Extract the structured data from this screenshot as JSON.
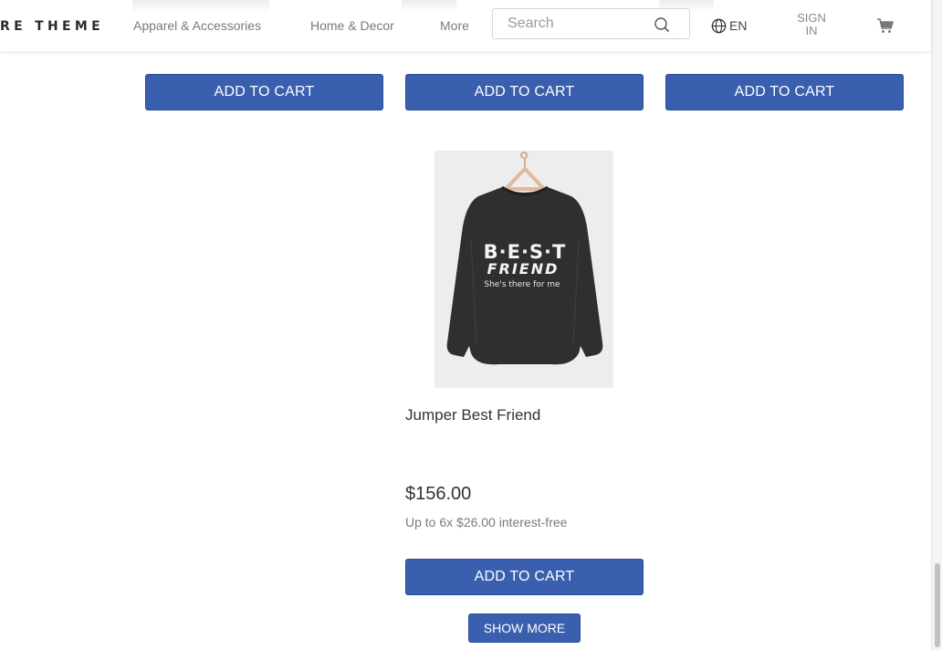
{
  "header": {
    "logo_text": "RE THEME",
    "nav": [
      "Apparel & Accessories",
      "Home & Decor",
      "More"
    ],
    "search": {
      "placeholder": "Search",
      "value": ""
    },
    "language": "EN",
    "signin_label": "SIGN IN"
  },
  "grid": {
    "add_to_cart_label": "ADD TO CART"
  },
  "product": {
    "name": "Jumper Best Friend",
    "price": "$156.00",
    "installments": "Up to 6x $26.00 interest-free",
    "print_line1": "B·E·S·T",
    "print_line2": "FRIEND",
    "print_line3": "She's there for me",
    "add_to_cart_label": "ADD TO CART"
  },
  "show_more_label": "SHOW MORE",
  "colors": {
    "button": "#3a5fae",
    "sweater": "#2e2f31"
  },
  "icons": [
    "search-icon",
    "globe-icon",
    "cart-icon",
    "hanger-icon"
  ]
}
